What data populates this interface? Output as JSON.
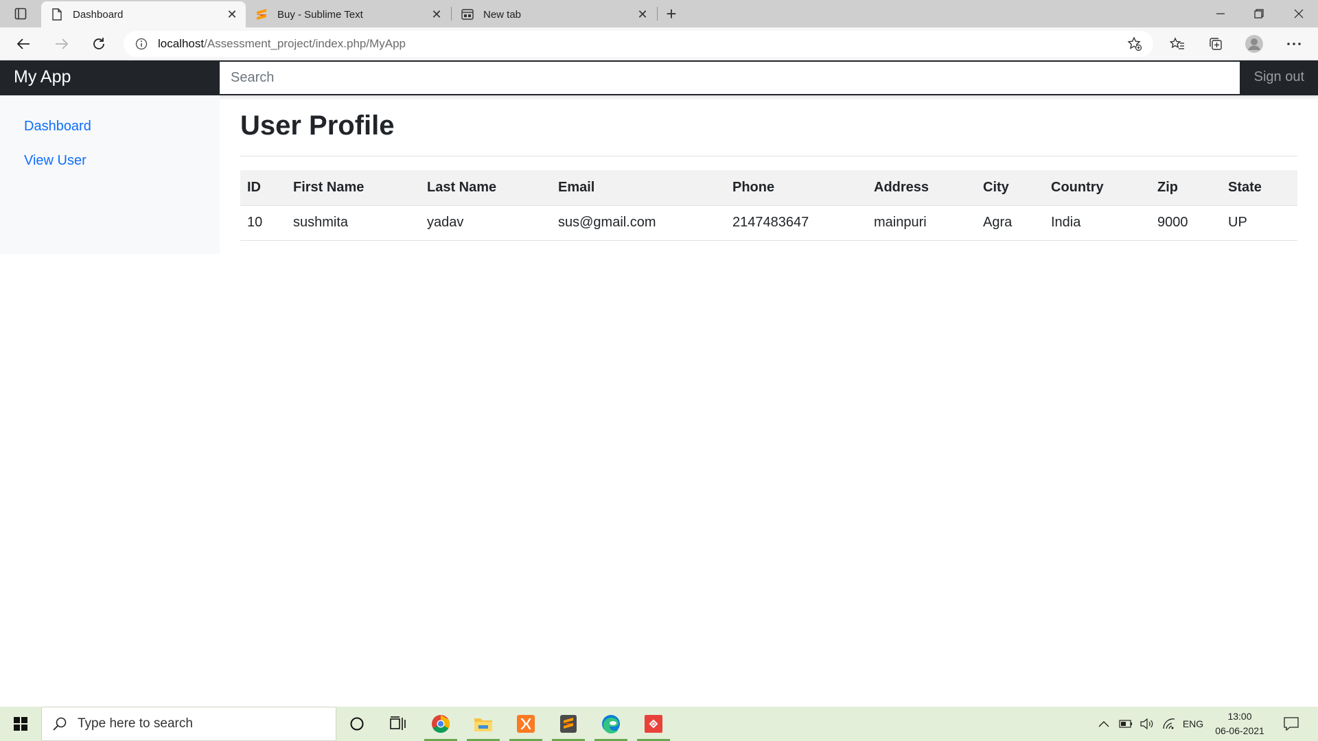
{
  "browser": {
    "tabs": [
      {
        "title": "Dashboard",
        "icon": "page-icon",
        "active": true
      },
      {
        "title": "Buy - Sublime Text",
        "icon": "sublime-icon",
        "active": false
      },
      {
        "title": "New tab",
        "icon": "newtab-icon",
        "active": false
      }
    ],
    "tab_close_glyph": "✕",
    "new_tab_glyph": "+",
    "url_host": "localhost",
    "url_path": "/Assessment_project/index.php/MyApp"
  },
  "app": {
    "brand": "My App",
    "search_placeholder": "Search",
    "signout_label": "Sign out",
    "sidebar": {
      "items": [
        {
          "label": "Dashboard"
        },
        {
          "label": "View User"
        }
      ]
    },
    "page_title": "User Profile",
    "table": {
      "columns": [
        "ID",
        "First Name",
        "Last Name",
        "Email",
        "Phone",
        "Address",
        "City",
        "Country",
        "Zip",
        "State"
      ],
      "rows": [
        [
          "10",
          "sushmita",
          "yadav",
          "sus@gmail.com",
          "2147483647",
          "mainpuri",
          "Agra",
          "India",
          "9000",
          "UP"
        ]
      ]
    }
  },
  "taskbar": {
    "search_placeholder": "Type here to search",
    "language": "ENG",
    "time": "13:00",
    "date": "06-06-2021"
  },
  "colors": {
    "navbar_bg": "#212529",
    "link": "#0d6efd",
    "taskbar_bg": "#e4efd9"
  }
}
